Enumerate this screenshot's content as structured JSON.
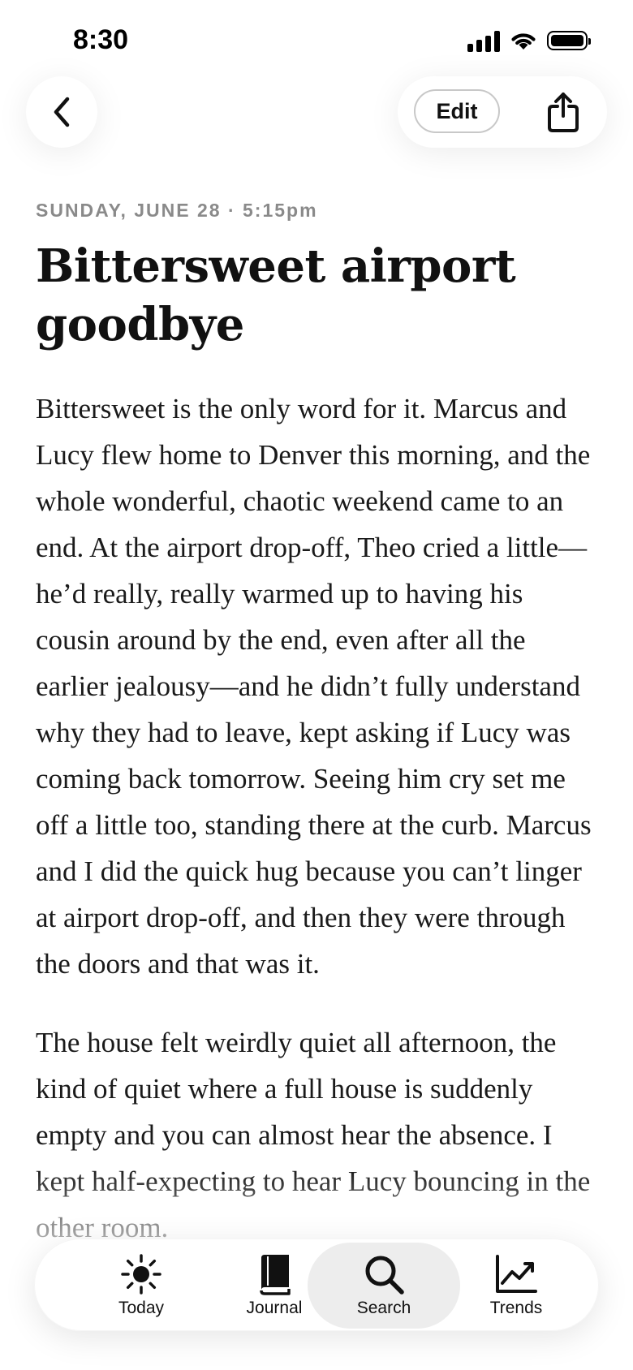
{
  "status_bar": {
    "time": "8:30"
  },
  "toolbar": {
    "edit_label": "Edit"
  },
  "entry": {
    "date": "SUNDAY, JUNE 28 · 5:15pm",
    "title": "Bittersweet airport goodbye",
    "paragraphs": [
      "Bittersweet is the only word for it. Marcus and Lucy flew home to Denver this morning, and the whole wonderful, chaotic weekend came to an end. At the airport drop-off, Theo cried a little—he’d really, really warmed up to having his cousin around by the end, even after all the earlier jealousy—and he didn’t fully understand why they had to leave, kept asking if Lucy was coming back tomorrow. Seeing him cry set me off a little too, standing there at the curb. Marcus and I did the quick hug because you can’t linger at airport drop-off, and then they were through the doors and that was it.",
      "The house felt weirdly quiet all afternoon, the kind of quiet where a full house is suddenly empty and you can almost hear the absence. I kept half-expecting to hear Lucy bouncing in the other room."
    ]
  },
  "tab_bar": {
    "tabs": [
      {
        "label": "Today",
        "icon": "sun-icon"
      },
      {
        "label": "Journal",
        "icon": "book-icon"
      },
      {
        "label": "Search",
        "icon": "magnifier-icon",
        "active": true
      },
      {
        "label": "Trends",
        "icon": "chart-icon"
      }
    ]
  }
}
